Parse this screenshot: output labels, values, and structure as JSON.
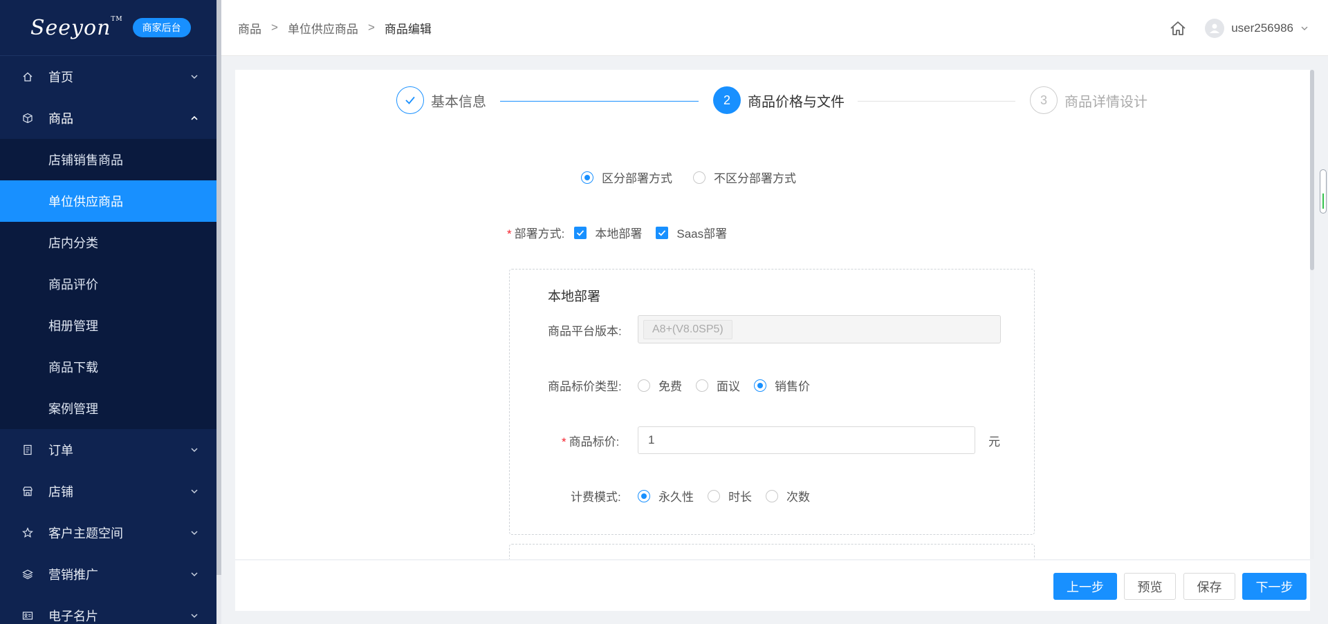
{
  "sidebar": {
    "logo": "Seeyon",
    "badge": "商家后台",
    "items": [
      {
        "label": "首页"
      },
      {
        "label": "商品"
      },
      {
        "label": "订单"
      },
      {
        "label": "店铺"
      },
      {
        "label": "客户主题空间"
      },
      {
        "label": "营销推广"
      },
      {
        "label": "电子名片"
      }
    ],
    "submenu": [
      {
        "label": "店铺销售商品"
      },
      {
        "label": "单位供应商品"
      },
      {
        "label": "店内分类"
      },
      {
        "label": "商品评价"
      },
      {
        "label": "相册管理"
      },
      {
        "label": "商品下载"
      },
      {
        "label": "案例管理"
      }
    ]
  },
  "header": {
    "breadcrumb": [
      "商品",
      "单位供应商品",
      "商品编辑"
    ],
    "separator": ">",
    "username": "user256986"
  },
  "steps": [
    {
      "num": "✓",
      "label": "基本信息"
    },
    {
      "num": "2",
      "label": "商品价格与文件"
    },
    {
      "num": "3",
      "label": "商品详情设计"
    }
  ],
  "form": {
    "mode_options": [
      "区分部署方式",
      "不区分部署方式"
    ],
    "deploy_label": "部署方式:",
    "deploy_options": [
      "本地部署",
      "Saas部署"
    ],
    "local": {
      "title": "本地部署",
      "platform_label": "商品平台版本:",
      "platform_value": "A8+(V8.0SP5)",
      "price_type_label": "商品标价类型:",
      "price_type_options": [
        "免费",
        "面议",
        "销售价"
      ],
      "price_label": "商品标价:",
      "price_value": "1",
      "price_unit": "元",
      "billing_label": "计费模式:",
      "billing_options": [
        "永久性",
        "时长",
        "次数"
      ]
    }
  },
  "footer": {
    "prev": "上一步",
    "preview": "预览",
    "save": "保存",
    "next": "下一步"
  },
  "colors": {
    "accent": "#1890ff",
    "sidebar_bg": "#0f2350",
    "required": "#f5222d"
  }
}
